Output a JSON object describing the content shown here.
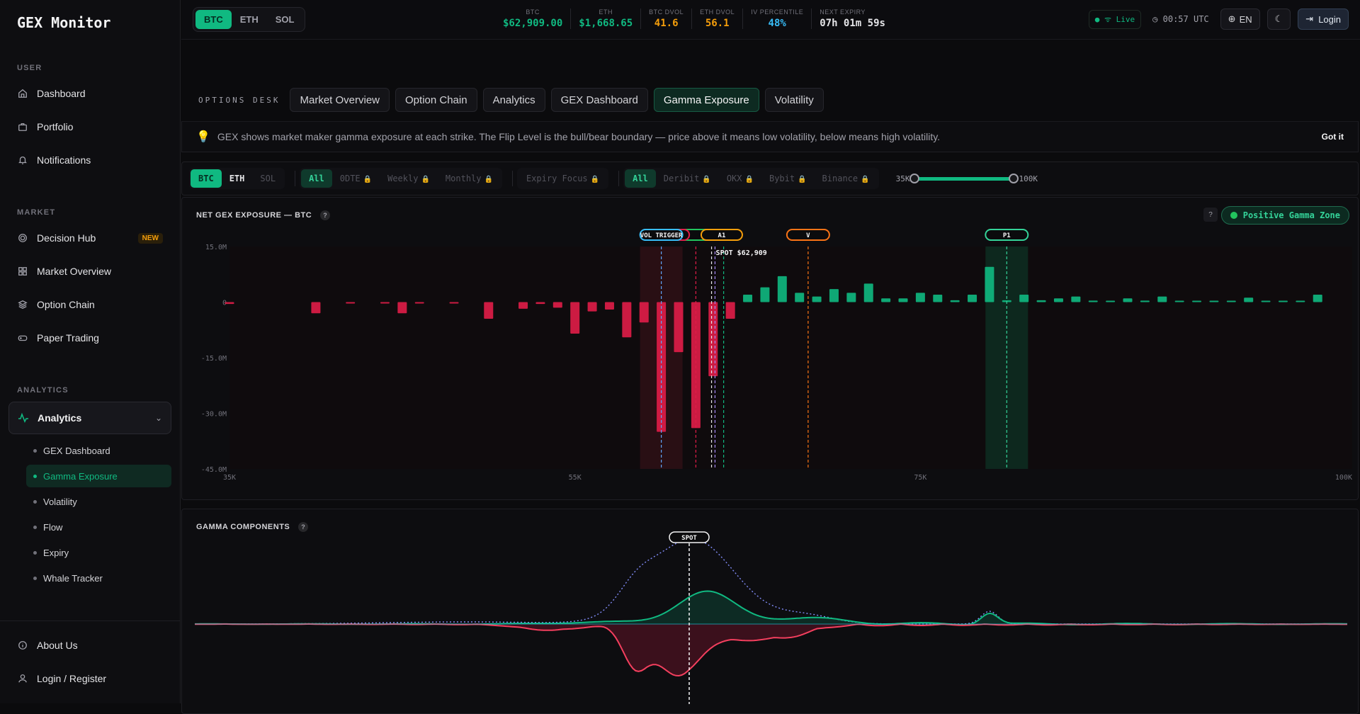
{
  "brand": "GEX Monitor",
  "sidebar": {
    "user_section": "USER",
    "user_items": [
      {
        "label": "Dashboard",
        "icon": "home-icon"
      },
      {
        "label": "Portfolio",
        "icon": "briefcase-icon"
      },
      {
        "label": "Notifications",
        "icon": "bell-icon"
      }
    ],
    "market_section": "MARKET",
    "market_items": [
      {
        "label": "Decision Hub",
        "icon": "target-icon",
        "badge": "NEW"
      },
      {
        "label": "Market Overview",
        "icon": "grid-icon"
      },
      {
        "label": "Option Chain",
        "icon": "layers-icon"
      },
      {
        "label": "Paper Trading",
        "icon": "gamepad-icon"
      }
    ],
    "analytics_section": "ANALYTICS",
    "analytics_label": "Analytics",
    "analytics_sub": [
      "GEX Dashboard",
      "Gamma Exposure",
      "Volatility",
      "Flow",
      "Expiry",
      "Whale Tracker"
    ],
    "about": "About Us",
    "login_register": "Login / Register"
  },
  "topbar": {
    "assets": [
      "BTC",
      "ETH",
      "SOL"
    ],
    "tickers": [
      {
        "label": "BTC",
        "value": "$62,909.00",
        "color": "#10b981"
      },
      {
        "label": "ETH",
        "value": "$1,668.65",
        "color": "#10b981"
      },
      {
        "label": "BTC DVOL",
        "value": "41.6",
        "color": "#f59e0b"
      },
      {
        "label": "ETH DVOL",
        "value": "56.1",
        "color": "#f59e0b"
      },
      {
        "label": "IV PERCENTILE",
        "value": "48%",
        "color": "#38bdf8"
      },
      {
        "label": "NEXT EXPIRY",
        "value": "07h 01m 59s",
        "color": "#e4e4e7"
      }
    ],
    "live": "Live",
    "clock": "00:57 UTC",
    "lang": "EN",
    "login": "Login"
  },
  "tabs": {
    "desk": "OPTIONS DESK",
    "items": [
      "Market Overview",
      "Option Chain",
      "Analytics",
      "GEX Dashboard",
      "Gamma Exposure",
      "Volatility"
    ]
  },
  "banner": {
    "text": "GEX shows market maker gamma exposure at each strike. The Flip Level is the bull/bear boundary — price above it means low volatility, below means high volatility.",
    "dismiss": "Got it"
  },
  "filters": {
    "assets": [
      "BTC",
      "ETH",
      "SOL"
    ],
    "expiry": [
      "All",
      "0DTE",
      "Weekly",
      "Monthly"
    ],
    "focus": "Expiry Focus",
    "exchanges": [
      "All",
      "Deribit",
      "OKX",
      "Bybit",
      "Binance"
    ],
    "range_min": "35K",
    "range_max": "100K"
  },
  "gex": {
    "title": "NET GEX EXPOSURE — BTC",
    "help": "?",
    "zone": "Positive Gamma Zone",
    "spot_label": "SPOT $62,909",
    "markers": [
      "VOL TRIGGER",
      "N",
      "A1",
      "V",
      "P1"
    ]
  },
  "chart_data": [
    {
      "type": "bar",
      "title": "NET GEX EXPOSURE — BTC",
      "xlim": [
        35000,
        100000
      ],
      "ylim": [
        -45,
        15
      ],
      "y_unit": "M",
      "yticks": [
        "15.0M",
        "0",
        "-15.0M",
        "-30.0M",
        "-45.0M"
      ],
      "xticks": [
        "35K",
        "55K",
        "75K",
        "100K"
      ],
      "strikes": [
        35000,
        40000,
        42000,
        44000,
        45000,
        46000,
        48000,
        50000,
        52000,
        53000,
        54000,
        55000,
        56000,
        57000,
        58000,
        59000,
        60000,
        61000,
        62000,
        63000,
        64000,
        65000,
        66000,
        67000,
        68000,
        69000,
        70000,
        71000,
        72000,
        73000,
        74000,
        75000,
        76000,
        77000,
        78000,
        79000,
        80000,
        81000,
        82000,
        83000,
        84000,
        85000,
        86000,
        87000,
        88000,
        89000,
        90000,
        91000,
        92000,
        93000,
        94000,
        95000,
        96000,
        97000,
        98000,
        99000,
        100000
      ],
      "values": [
        -0.5,
        -3,
        -0.3,
        -0.3,
        -3,
        -0.3,
        -0.3,
        -4.5,
        -1.8,
        -0.5,
        -1.5,
        -8.5,
        -2.5,
        -2,
        -9.5,
        -5.5,
        -35,
        -13.5,
        -34,
        -20,
        -4.5,
        2,
        4,
        7,
        2.5,
        1.5,
        3.5,
        2.5,
        5,
        1,
        1,
        2.5,
        2,
        0.5,
        2,
        9.5,
        0.5,
        2,
        0.5,
        1,
        1.5,
        0.4,
        0.3,
        1,
        0.4,
        1.5,
        0.3,
        0.3,
        0.3,
        0.3,
        1.2,
        0.3,
        0.3,
        0.3,
        2
      ],
      "levels": {
        "vol_trigger": 60000,
        "spot": 62909,
        "a1": 63500,
        "v": 68500,
        "p1": 80000
      }
    },
    {
      "type": "area",
      "title": "GAMMA COMPONENTS",
      "spot_label": "SPOT",
      "series": []
    }
  ],
  "components": {
    "title": "GAMMA COMPONENTS",
    "spot": "SPOT"
  }
}
